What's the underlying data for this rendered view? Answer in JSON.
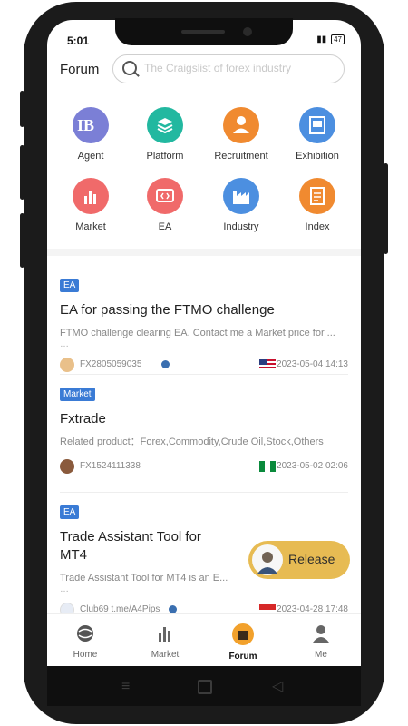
{
  "status_bar": {
    "time": "5:01",
    "battery": "47"
  },
  "header": {
    "title": "Forum",
    "search_placeholder": "The Craigslist of forex industry"
  },
  "categories": [
    {
      "label": "Agent",
      "icon": "ib-icon",
      "color": "#7b7fd6"
    },
    {
      "label": "Platform",
      "icon": "layers-icon",
      "color": "#22b8a0"
    },
    {
      "label": "Recruitment",
      "icon": "person-icon",
      "color": "#f08a30"
    },
    {
      "label": "Exhibition",
      "icon": "exhibition-icon",
      "color": "#4c8fe0"
    },
    {
      "label": "Market",
      "icon": "bar-chart-icon",
      "color": "#f06a6a"
    },
    {
      "label": "EA",
      "icon": "ea-icon",
      "color": "#f06a6a"
    },
    {
      "label": "Industry",
      "icon": "factory-icon",
      "color": "#4c8fe0"
    },
    {
      "label": "Index",
      "icon": "document-icon",
      "color": "#f08a30"
    }
  ],
  "posts": [
    {
      "tag": "EA",
      "title": "EA for passing the FTMO challenge",
      "desc": "FTMO challenge clearing EA. Contact me a Market price for ...",
      "user": "FX2805059035",
      "date": "2023-05-04 14:13",
      "flag": "us-flag"
    },
    {
      "tag": "Market",
      "title": "Fxtrade",
      "desc": "Related product：Forex,Commodity,Crude Oil,Stock,Others",
      "user": "FX1524111338",
      "date": "2023-05-02 02:06",
      "flag": "nigeria-flag"
    },
    {
      "tag": "EA",
      "title": "Trade Assistant Tool for MT4",
      "desc": "Trade Assistant Tool for MT4 is an E...",
      "user": "Club69 t.me/A4Pips",
      "date": "2023-04-28 17:48",
      "flag": "indonesia-flag"
    }
  ],
  "release_button": {
    "label": "Release"
  },
  "nav": {
    "home": "Home",
    "market": "Market",
    "forum": "Forum",
    "me": "Me"
  },
  "colors": {
    "tag_blue": "#3a7bd5",
    "release": "#e6b84a",
    "forum_active": "#f2a12c"
  }
}
